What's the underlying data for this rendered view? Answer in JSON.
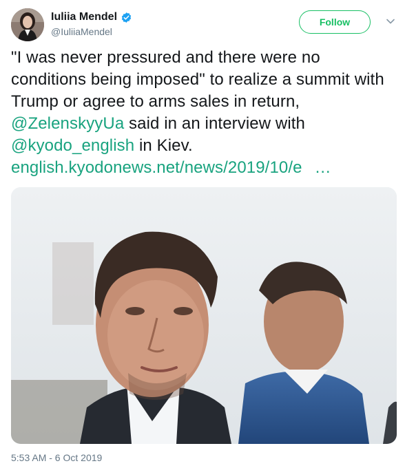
{
  "user": {
    "display_name": "Iuliia Mendel",
    "handle": "@IuliiaMendel",
    "verified": true
  },
  "actions": {
    "follow_label": "Follow",
    "menu_icon": "chevron-down-icon"
  },
  "tweet": {
    "text_1": "\"I was never pressured and there were no conditions being imposed\" to realize a summit with Trump or agree to arms sales in return, ",
    "mention_1": "@ZelenskyyUa",
    "text_2": " said in an interview with ",
    "mention_2": "@kyodo_english",
    "text_3": " in Kiev.",
    "link": "english.kyodonews.net/news/2019/10/e",
    "link_ellipsis": "…"
  },
  "media": {
    "icon": "photo"
  },
  "meta": {
    "timestamp": "5:53 AM - 6 Oct 2019"
  },
  "colors": {
    "accent": "#17bf63",
    "link": "#19a37f",
    "text": "#14171a",
    "secondary": "#657786",
    "verified": "#1da1f2"
  }
}
